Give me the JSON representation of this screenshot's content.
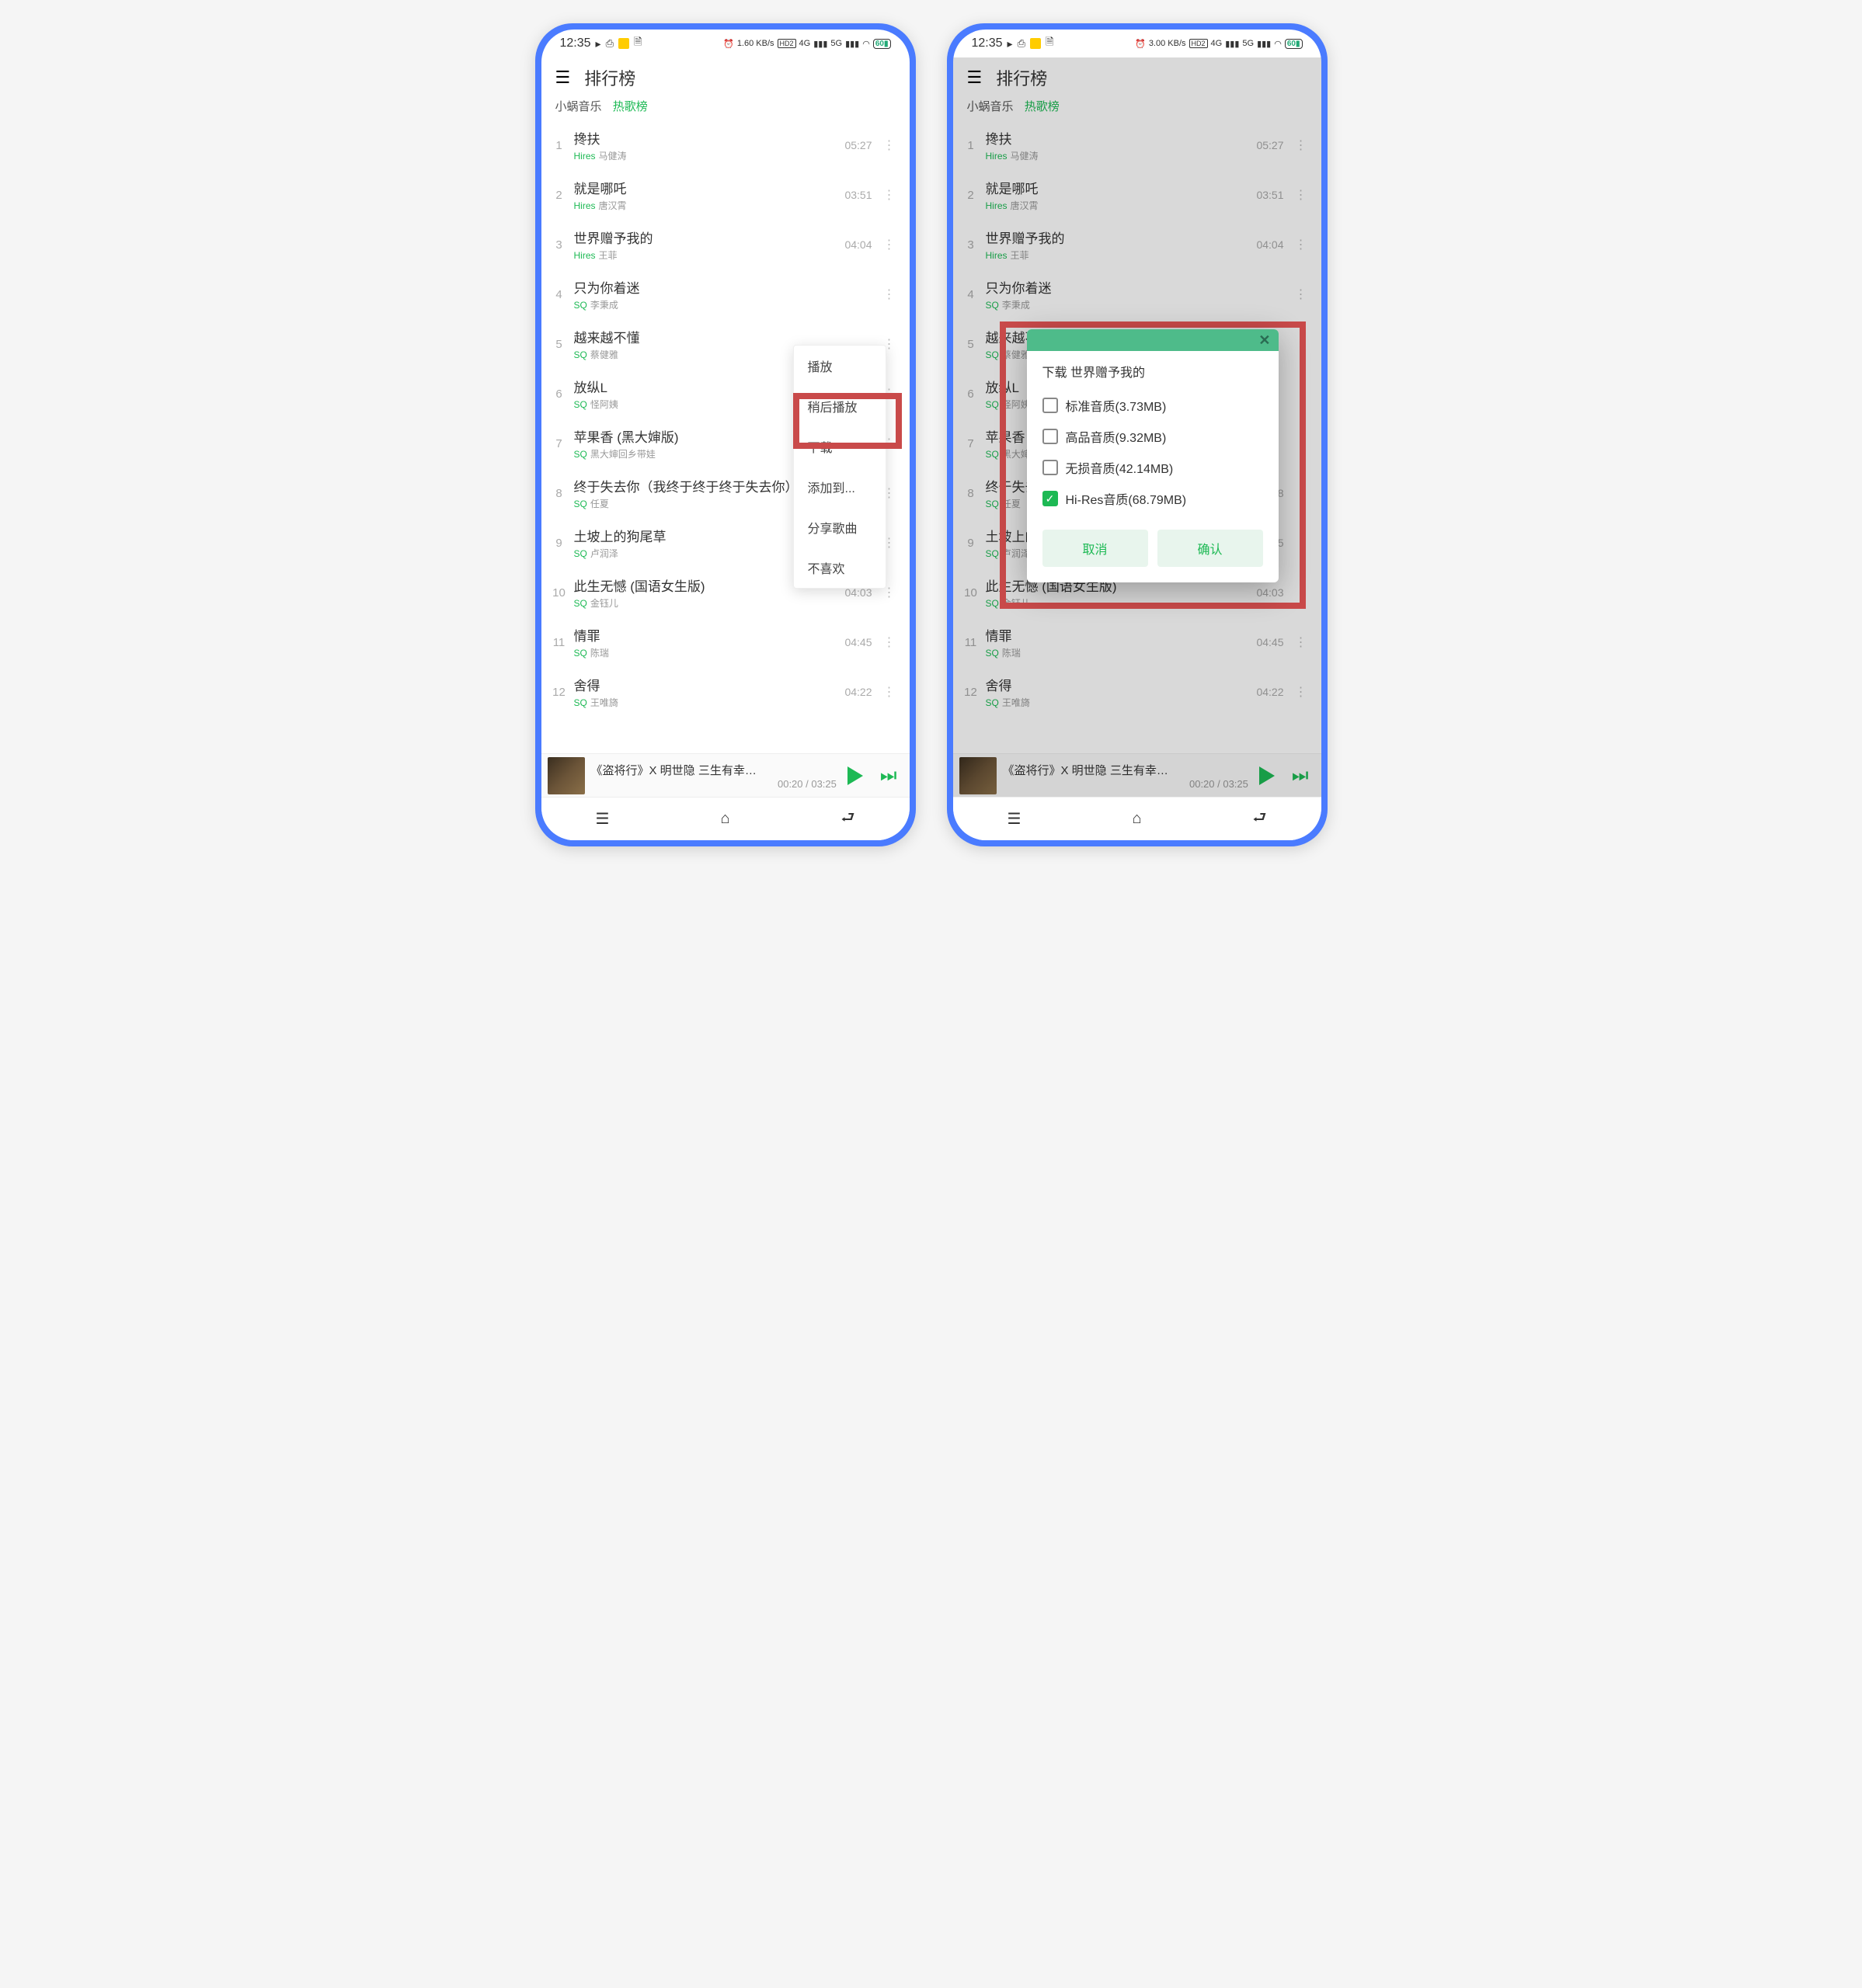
{
  "status": {
    "time": "12:35",
    "speed": "1.60 KB/s",
    "hd": "HD2",
    "net4g": "4G",
    "net5g": "5G",
    "battery": "60"
  },
  "status2_speed": "3.00 KB/s",
  "header": {
    "title": "排行榜"
  },
  "breadcrumb": {
    "app": "小蜗音乐",
    "category": "热歌榜"
  },
  "songs": [
    {
      "n": "1",
      "title": "搀扶",
      "quality": "Hires",
      "artist": "马健涛",
      "dur": "05:27"
    },
    {
      "n": "2",
      "title": "就是哪吒",
      "quality": "Hires",
      "artist": "唐汉霄",
      "dur": "03:51"
    },
    {
      "n": "3",
      "title": "世界赠予我的",
      "quality": "Hires",
      "artist": "王菲",
      "dur": "04:04"
    },
    {
      "n": "4",
      "title": "只为你着迷",
      "quality": "SQ",
      "artist": "李秉成",
      "dur": ""
    },
    {
      "n": "5",
      "title": "越来越不懂",
      "quality": "SQ",
      "artist": "蔡健雅",
      "dur": ""
    },
    {
      "n": "6",
      "title": "放纵L",
      "quality": "SQ",
      "artist": "怪阿姨",
      "dur": ""
    },
    {
      "n": "7",
      "title": "苹果香 (黑大婶版)",
      "quality": "SQ",
      "artist": "黑大婶回乡带娃",
      "dur": ""
    },
    {
      "n": "8",
      "title": "终于失去你（我终于终于终于失去你）",
      "quality": "SQ",
      "artist": "任夏",
      "dur": "03:28"
    },
    {
      "n": "9",
      "title": "土坡上的狗尾草",
      "quality": "SQ",
      "artist": "卢润泽",
      "dur": "03:15"
    },
    {
      "n": "10",
      "title": "此生无憾 (国语女生版)",
      "quality": "SQ",
      "artist": "金钰儿",
      "dur": "04:03"
    },
    {
      "n": "11",
      "title": "情罪",
      "quality": "SQ",
      "artist": "陈瑞",
      "dur": "04:45"
    },
    {
      "n": "12",
      "title": "舍得",
      "quality": "SQ",
      "artist": "王唯旖",
      "dur": "04:22"
    }
  ],
  "ctx_menu": {
    "play": "播放",
    "later": "稍后播放",
    "download": "下载",
    "addto": "添加到...",
    "share": "分享歌曲",
    "dislike": "不喜欢"
  },
  "modal": {
    "title": "下载 世界赠予我的",
    "opts": [
      {
        "label": "标准音质(3.73MB)",
        "checked": false
      },
      {
        "label": "高品音质(9.32MB)",
        "checked": false
      },
      {
        "label": "无损音质(42.14MB)",
        "checked": false
      },
      {
        "label": "Hi-Res音质(68.79MB)",
        "checked": true
      }
    ],
    "cancel": "取消",
    "confirm": "确认"
  },
  "player": {
    "title": "《盗将行》X 明世隐 三生有幸…",
    "time": "00:20 / 03:25"
  }
}
